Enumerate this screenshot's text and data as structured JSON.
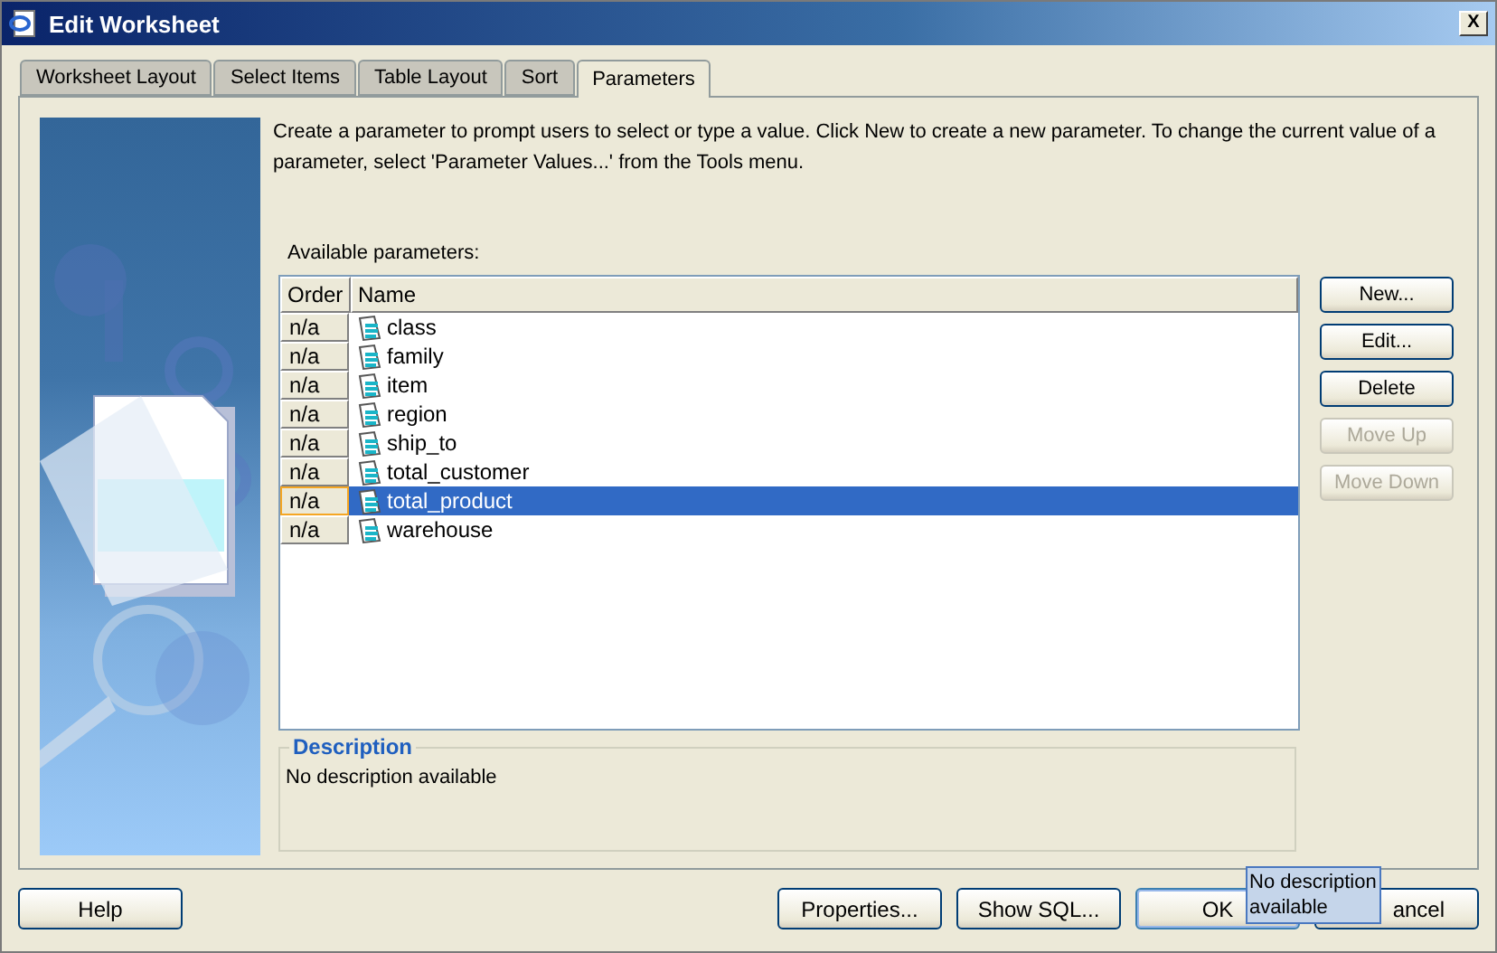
{
  "window": {
    "title": "Edit Worksheet",
    "close": "X"
  },
  "tabs": [
    {
      "label": "Worksheet Layout",
      "selected": false
    },
    {
      "label": "Select Items",
      "selected": false
    },
    {
      "label": "Table Layout",
      "selected": false
    },
    {
      "label": "Sort",
      "selected": false
    },
    {
      "label": "Parameters",
      "selected": true
    }
  ],
  "intro": "Create a parameter to prompt users to select or type a value. Click New to create a new parameter. To change the current value of a parameter, select 'Parameter Values...' from the Tools menu.",
  "list_label": "Available parameters:",
  "table": {
    "columns": [
      "Order",
      "Name"
    ],
    "rows": [
      {
        "order": "n/a",
        "name": "class",
        "selected": false
      },
      {
        "order": "n/a",
        "name": "family",
        "selected": false
      },
      {
        "order": "n/a",
        "name": "item",
        "selected": false
      },
      {
        "order": "n/a",
        "name": "region",
        "selected": false
      },
      {
        "order": "n/a",
        "name": "ship_to",
        "selected": false
      },
      {
        "order": "n/a",
        "name": "total_customer",
        "selected": false
      },
      {
        "order": "n/a",
        "name": "total_product",
        "selected": true
      },
      {
        "order": "n/a",
        "name": "warehouse",
        "selected": false
      }
    ]
  },
  "side_buttons": [
    {
      "label": "New...",
      "disabled": false
    },
    {
      "label": "Edit...",
      "disabled": false
    },
    {
      "label": "Delete",
      "disabled": false
    },
    {
      "label": "Move Up",
      "disabled": true
    },
    {
      "label": "Move Down",
      "disabled": true
    }
  ],
  "description": {
    "title": "Description",
    "text": "No description available"
  },
  "footer": {
    "help": "Help",
    "buttons": [
      {
        "label": "Properties...",
        "default": false
      },
      {
        "label": "Show SQL...",
        "default": false
      },
      {
        "label": "OK",
        "default": true
      },
      {
        "label": "ancel",
        "default": false
      }
    ]
  },
  "tooltip": "No description available"
}
